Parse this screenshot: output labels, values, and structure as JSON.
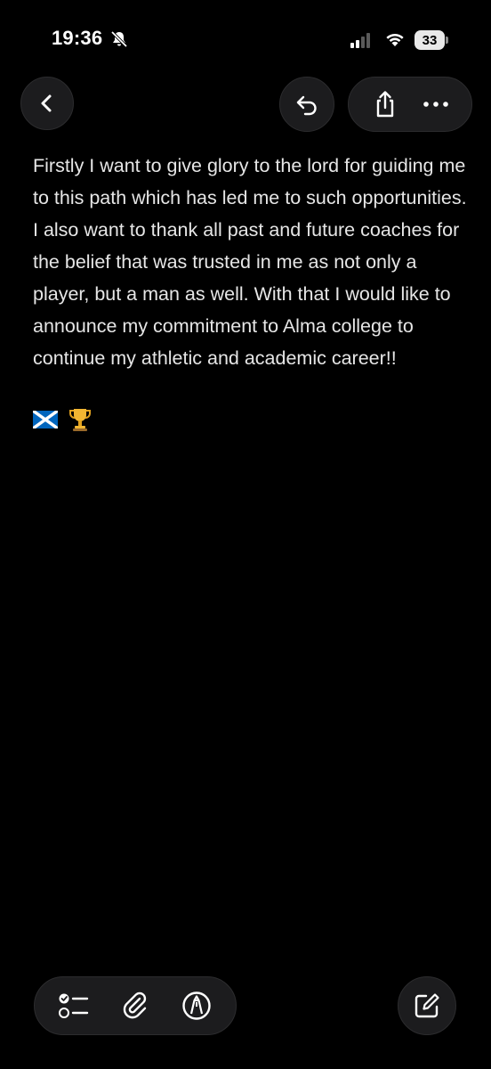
{
  "status_bar": {
    "time": "19:36",
    "battery": "33",
    "icons": [
      "bell-slash-icon",
      "cellular-signal-icon",
      "wifi-icon",
      "battery-icon"
    ]
  },
  "nav": {
    "icons": [
      "chevron-left-icon",
      "undo-icon",
      "share-icon",
      "more-icon"
    ]
  },
  "note": {
    "text": "Firstly I want to give glory to the lord for guiding me to this path which has led me to such opportunities. I also want to thank all past and future coaches for the belief that was trusted in me as not only a player, but a man as well. With that I would like to announce my commitment to Alma college to continue my athletic and academic career!!",
    "emojis": [
      "scotland-flag-icon",
      "trophy-icon"
    ]
  },
  "toolbar": {
    "icons": [
      "checklist-icon",
      "paperclip-icon",
      "markup-pen-icon",
      "compose-icon"
    ]
  },
  "colors": {
    "background": "#000000",
    "button_fill": "#1c1c1e",
    "text": "#e6e6e6"
  }
}
